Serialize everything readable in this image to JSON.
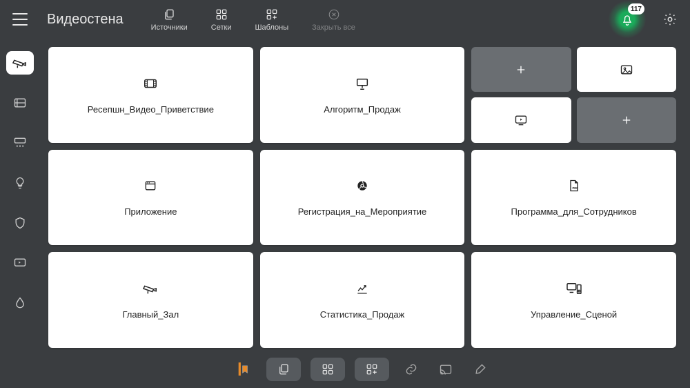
{
  "header": {
    "title": "Видеостена",
    "tabs": [
      {
        "label": "Источники"
      },
      {
        "label": "Сетки"
      },
      {
        "label": "Шаблоны"
      },
      {
        "label": "Закрыть все"
      }
    ],
    "notification_count": "117"
  },
  "cards": {
    "c0": "Ресепшн_Видео_Приветствие",
    "c1": "Алгоритм_Продаж",
    "c3": "Приложение",
    "c4": "Регистрация_на_Мероприятие",
    "c5": "Программа_для_Сотрудников",
    "c6": "Главный_Зал",
    "c7": "Статистика_Продаж",
    "c8": "Управление_Сценой"
  }
}
